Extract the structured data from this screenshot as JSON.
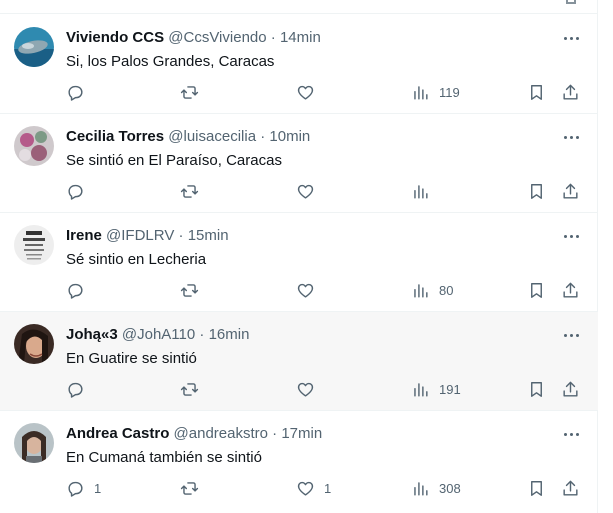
{
  "tweets": [
    {
      "name": "Viviendo CCS",
      "handle": "@CcsViviendo",
      "separator": "·",
      "time": "14min",
      "text": "Si, los Palos Grandes, Caracas",
      "reply_count": "",
      "retweet_count": "",
      "like_count": "",
      "views": "119"
    },
    {
      "name": "Cecilia Torres",
      "handle": "@luisacecilia",
      "separator": "·",
      "time": "10min",
      "text": "Se sintió en El Paraíso, Caracas",
      "reply_count": "",
      "retweet_count": "",
      "like_count": "",
      "views": ""
    },
    {
      "name": "Irene",
      "handle": "@IFDLRV",
      "separator": "·",
      "time": "15min",
      "text": "Sé sintio en Lecheria",
      "reply_count": "",
      "retweet_count": "",
      "like_count": "",
      "views": "80"
    },
    {
      "name": "Johą«3",
      "handle": "@JohA110",
      "separator": "·",
      "time": "16min",
      "text": "En Guatire se sintió",
      "reply_count": "",
      "retweet_count": "",
      "like_count": "",
      "views": "191"
    },
    {
      "name": "Andrea Castro",
      "handle": "@andreakstro",
      "separator": "·",
      "time": "17min",
      "text": "En Cumaná también se sintió",
      "reply_count": "1",
      "retweet_count": "",
      "like_count": "1",
      "views": "308"
    }
  ],
  "icons": {
    "reply": "reply-icon",
    "retweet": "retweet-icon",
    "like": "heart-icon",
    "views": "views-chart-icon",
    "bookmark": "bookmark-icon",
    "share": "share-icon",
    "more": "more-dots-icon"
  },
  "colors": {
    "text": "#0f1419",
    "secondary": "#536471",
    "divider": "#eff3f4",
    "hover_bg": "#f7f7f7"
  }
}
